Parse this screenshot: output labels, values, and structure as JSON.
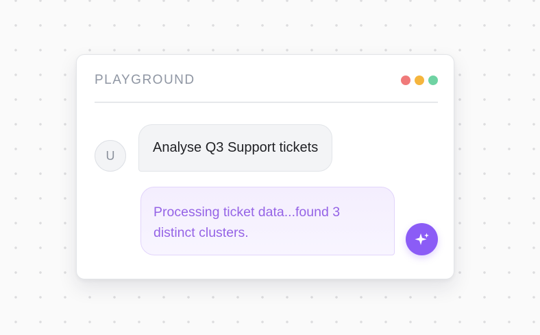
{
  "window": {
    "title": "PLAYGROUND",
    "controls": [
      {
        "name": "red-dot",
        "color": "#f07a7a"
      },
      {
        "name": "yellow-dot",
        "color": "#f5b53d"
      },
      {
        "name": "green-dot",
        "color": "#6fd3a3"
      }
    ]
  },
  "chat": {
    "user": {
      "avatar_initial": "U",
      "message": "Analyse Q3 Support tickets"
    },
    "assistant": {
      "message": "Processing ticket data...found 3 distinct clusters.",
      "avatar_icon": "sparkle-icon"
    }
  },
  "colors": {
    "accent": "#8b5cf6",
    "assistant_text": "#9563e6"
  }
}
